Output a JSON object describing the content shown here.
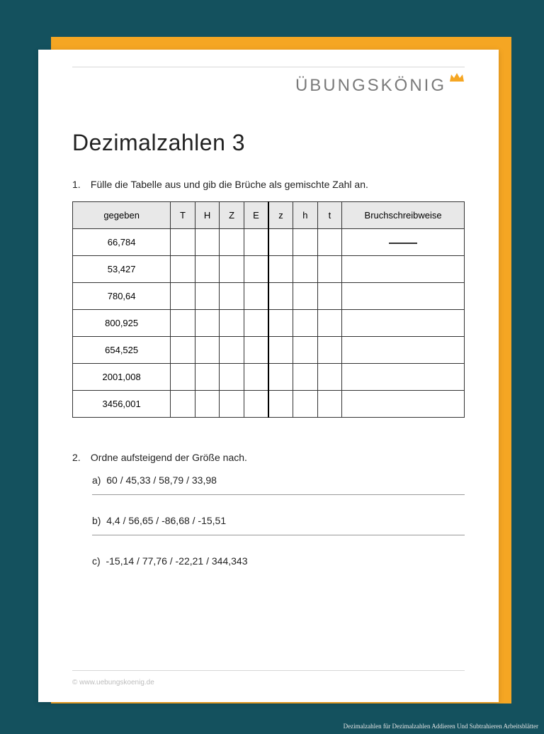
{
  "brand": "ÜBUNGSKÖNIG",
  "title": "Dezimalzahlen 3",
  "task1": {
    "num": "1.",
    "text": "Fülle die Tabelle aus und gib die Brüche als gemischte Zahl an.",
    "headers": {
      "given": "gegeben",
      "T": "T",
      "H": "H",
      "Z": "Z",
      "E": "E",
      "z": "z",
      "h": "h",
      "t": "t",
      "bruch": "Bruchschreibweise"
    },
    "rows": [
      {
        "given": "66,784"
      },
      {
        "given": "53,427"
      },
      {
        "given": "780,64"
      },
      {
        "given": "800,925"
      },
      {
        "given": "654,525"
      },
      {
        "given": "2001,008"
      },
      {
        "given": "3456,001"
      }
    ]
  },
  "task2": {
    "num": "2.",
    "text": "Ordne aufsteigend der Größe nach.",
    "items": [
      {
        "label": "a)",
        "values": "60 / 45,33 / 58,79 / 33,98"
      },
      {
        "label": "b)",
        "values": "4,4 / 56,65 / -86,68 / -15,51"
      },
      {
        "label": "c)",
        "values": "-15,14 / 77,76 / -22,21 / 344,343"
      }
    ]
  },
  "footer": "© www.uebungskoenig.de",
  "caption": "Dezimalzahlen für Dezimalzahlen Addieren Und Subtrahieren Arbeitsblätter"
}
